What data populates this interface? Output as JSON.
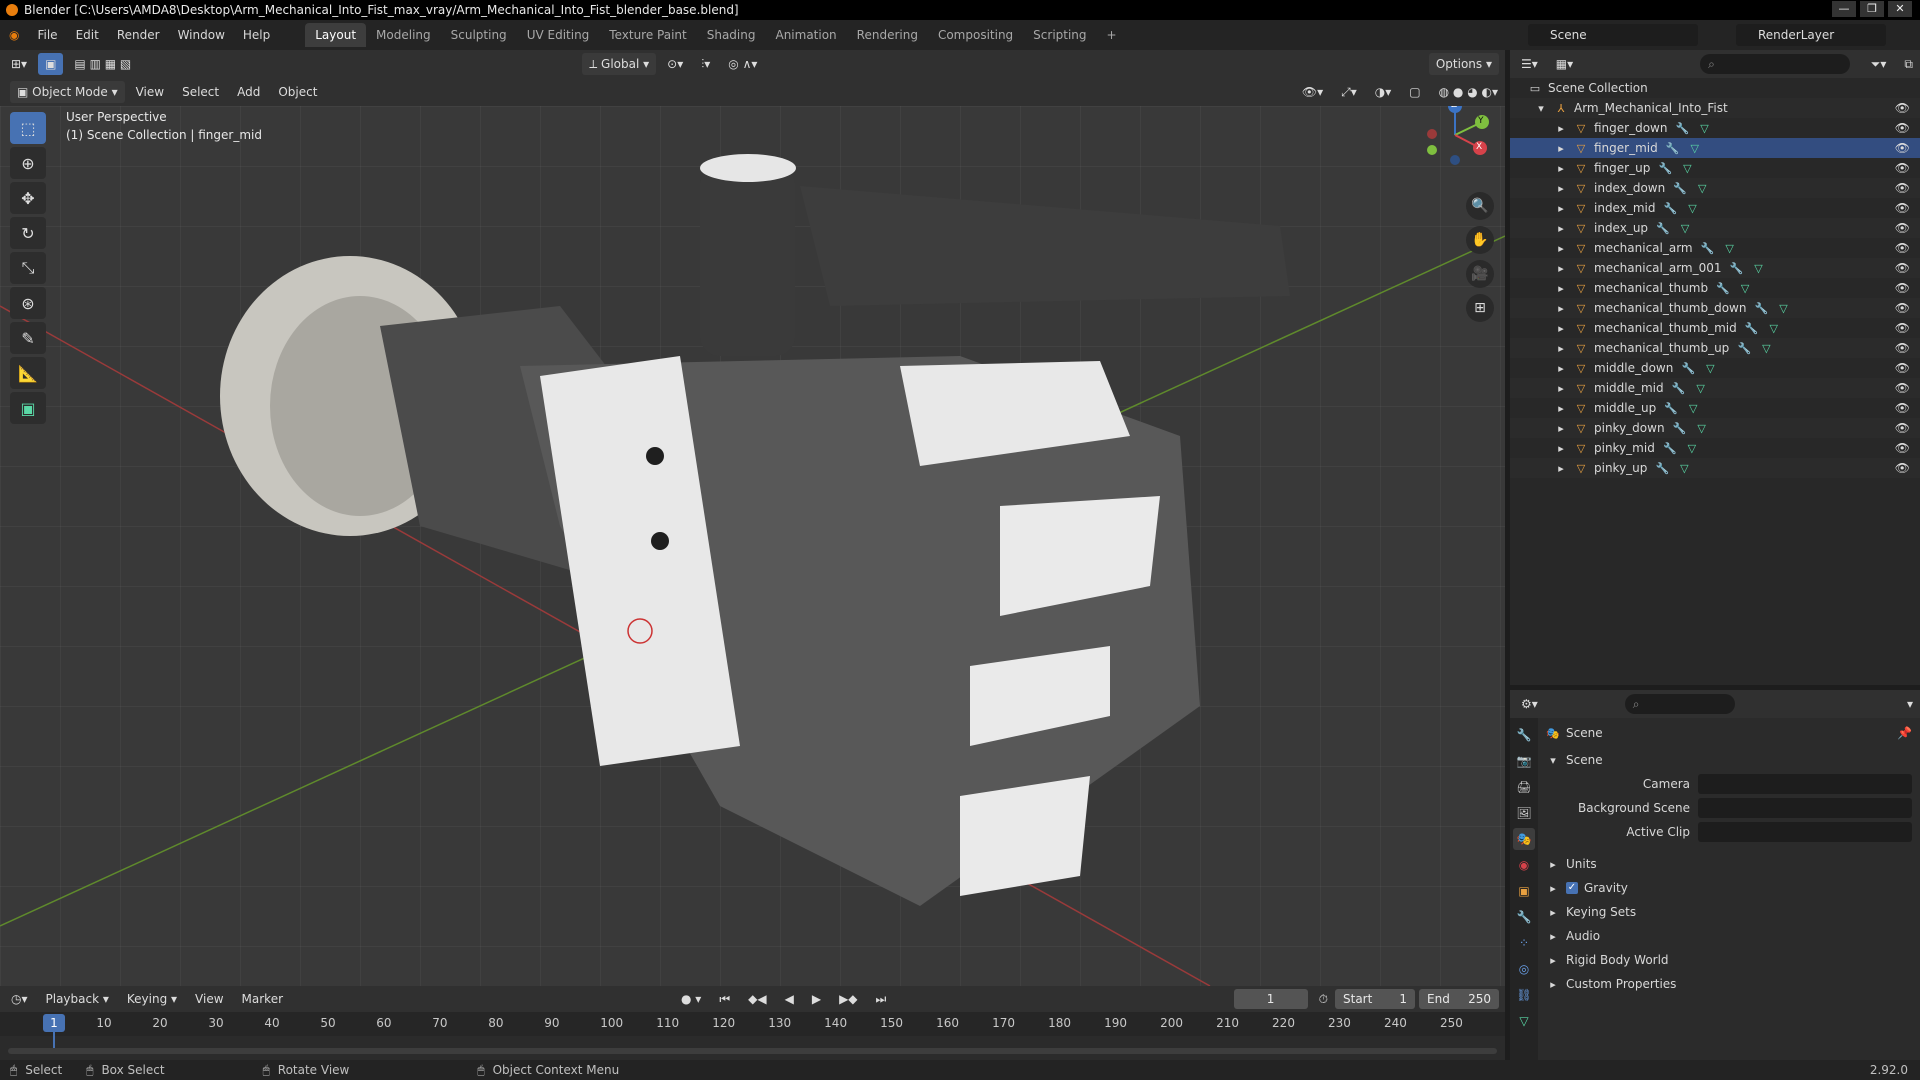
{
  "window": {
    "title": "Blender [C:\\Users\\AMDA8\\Desktop\\Arm_Mechanical_Into_Fist_max_vray/Arm_Mechanical_Into_Fist_blender_base.blend]",
    "controls": [
      "—",
      "❐",
      "✕"
    ]
  },
  "menu": [
    "File",
    "Edit",
    "Render",
    "Window",
    "Help"
  ],
  "workspaces": [
    "Layout",
    "Modeling",
    "Sculpting",
    "UV Editing",
    "Texture Paint",
    "Shading",
    "Animation",
    "Rendering",
    "Compositing",
    "Scripting"
  ],
  "active_workspace": "Layout",
  "add_workspace": "+",
  "scene_name": "Scene",
  "render_layer": "RenderLayer",
  "viewport": {
    "transform_orientation": "Global",
    "options_label": "Options",
    "mode": "Object Mode",
    "header_menus": [
      "View",
      "Select",
      "Add",
      "Object"
    ],
    "perspective": "User Perspective",
    "context": "(1) Scene Collection | finger_mid",
    "gizmo_axes": [
      "Z",
      "Y",
      "X"
    ]
  },
  "outliner": {
    "root": "Scene Collection",
    "collection": "Arm_Mechanical_Into_Fist",
    "active_item": "finger_mid",
    "items": [
      "finger_down",
      "finger_mid",
      "finger_up",
      "index_down",
      "index_mid",
      "index_up",
      "mechanical_arm",
      "mechanical_arm_001",
      "mechanical_thumb",
      "mechanical_thumb_down",
      "mechanical_thumb_mid",
      "mechanical_thumb_up",
      "middle_down",
      "middle_mid",
      "middle_up",
      "pinky_down",
      "pinky_mid",
      "pinky_up"
    ]
  },
  "properties": {
    "breadcrumb": "Scene",
    "panel": "Scene",
    "fields": [
      "Camera",
      "Background Scene",
      "Active Clip"
    ],
    "sections": [
      "Units",
      "Gravity",
      "Keying Sets",
      "Audio",
      "Rigid Body World",
      "Custom Properties"
    ],
    "gravity_checked": true
  },
  "timeline": {
    "menus": [
      "Playback",
      "Keying",
      "View",
      "Marker"
    ],
    "current_frame": "1",
    "start_label": "Start",
    "start": "1",
    "end_label": "End",
    "end": "250",
    "ticks": [
      "1",
      "10",
      "20",
      "30",
      "40",
      "50",
      "60",
      "70",
      "80",
      "90",
      "100",
      "110",
      "120",
      "130",
      "140",
      "150",
      "160",
      "170",
      "180",
      "190",
      "200",
      "210",
      "220",
      "230",
      "240",
      "250"
    ]
  },
  "statusbar": {
    "items": [
      "Select",
      "Box Select",
      "Rotate View",
      "Object Context Menu"
    ],
    "version": "2.92.0"
  }
}
